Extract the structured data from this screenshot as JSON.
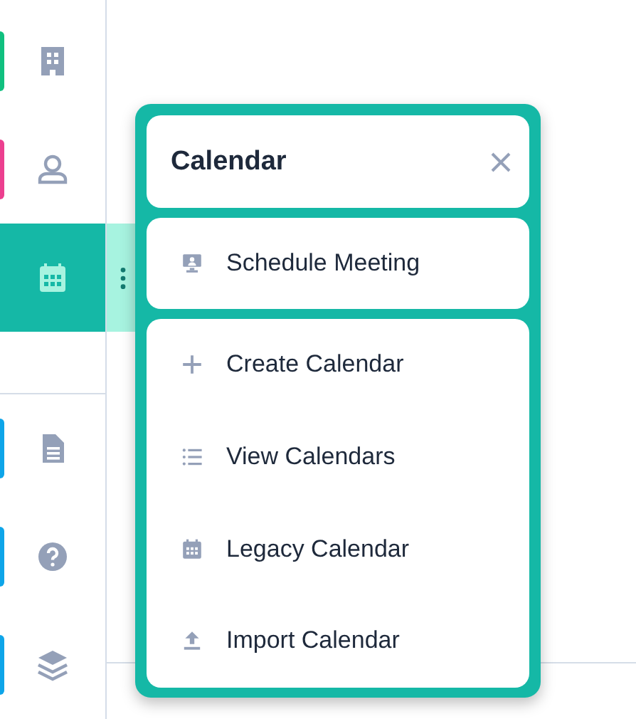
{
  "sidebar": {
    "top_items": [
      {
        "color": "#10c07f",
        "selected": false
      },
      {
        "color": "#ec3f8f",
        "selected": false
      },
      {
        "color": "#15b8a6",
        "selected": true
      }
    ],
    "bottom_items": [
      {
        "color": "#0ea5e9",
        "selected": false
      },
      {
        "color": "#0ea5e9",
        "selected": false
      },
      {
        "color": "#0ea5e9",
        "selected": false
      }
    ]
  },
  "menu": {
    "title": "Calendar",
    "sections": [
      {
        "items": [
          {
            "label": "Schedule Meeting"
          }
        ]
      },
      {
        "items": [
          {
            "label": "Create Calendar"
          },
          {
            "label": "View Calendars"
          },
          {
            "label": "Legacy Calendar"
          },
          {
            "label": "Import Calendar"
          }
        ]
      }
    ]
  }
}
